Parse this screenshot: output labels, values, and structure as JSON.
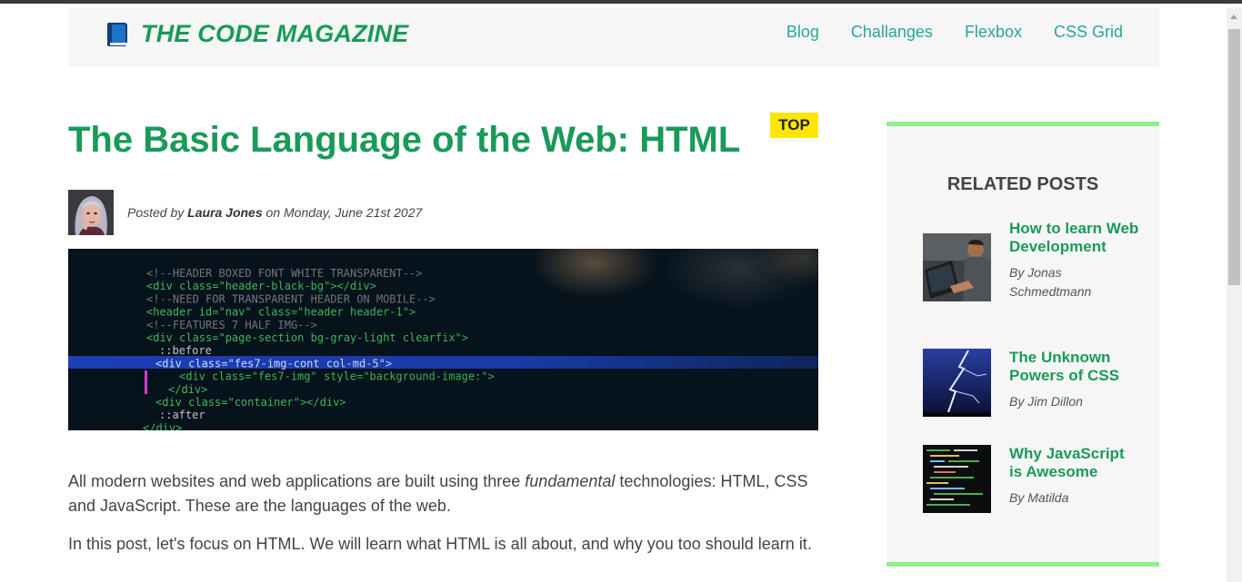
{
  "header": {
    "brand": "THE CODE MAGAZINE",
    "nav": [
      "Blog",
      "Challanges",
      "Flexbox",
      "CSS Grid"
    ]
  },
  "post": {
    "title": "The Basic Language of the Web: HTML",
    "badge": "TOP",
    "meta_prefix": "Posted by ",
    "author": "Laura Jones",
    "meta_suffix": " on Monday, June 21st 2027",
    "p1_a": "All modern websites and web applications are built using three ",
    "p1_em": "fundamental",
    "p1_b": " technologies: HTML, CSS and JavaScript. These are the languages of the web.",
    "p2": "In this post, let's focus on HTML. We will learn what HTML is all about, and why you too should learn it."
  },
  "sidebar": {
    "title": "RELATED POSTS",
    "items": [
      {
        "title": "How to learn Web Development",
        "author": "By Jonas Schmedtmann"
      },
      {
        "title": "The Unknown Powers of CSS",
        "author": "By Jim Dillon"
      },
      {
        "title": "Why JavaScript is Awesome",
        "author": "By Matilda"
      }
    ]
  },
  "code_lines": [
    "<!--HEADER BOXED FONT WHITE TRANSPARENT-->",
    "<div class=\"header-black-bg\"></div>",
    "<!--NEED FOR TRANSPARENT HEADER ON MOBILE-->",
    "<header id=\"nav\" class=\"header header-1\">",
    "<!--FEATURES 7 HALF IMG-->",
    "<div class=\"page-section bg-gray-light clearfix\">",
    "::before",
    "<div class=\"fes7-img-cont col-md-5\">",
    "<div class=\"fes7-img\" style=\"background-image:\">",
    "</div>",
    "<div class=\"container\"></div>",
    "::after",
    "</div>"
  ],
  "colors": {
    "brand_green": "#1a9a58",
    "nav_teal": "#2aa3a0",
    "badge_yellow": "#ffe600",
    "sidebar_border": "#8ef08a"
  }
}
